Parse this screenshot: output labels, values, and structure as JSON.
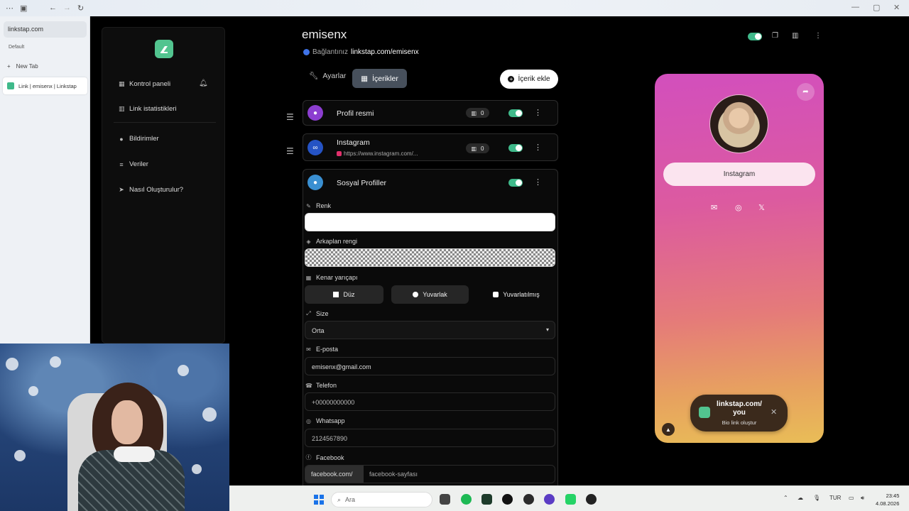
{
  "browser": {
    "address": "linkstap.com",
    "profile": "Default",
    "new_tab": "New Tab",
    "active_tab": "Link | emisenx | Linkstap"
  },
  "sidebar": {
    "items": [
      {
        "label": "Kontrol paneli",
        "icon": "table-icon"
      },
      {
        "label": "Link istatistikleri",
        "icon": "chart-icon"
      },
      {
        "label": "Bildirimler",
        "icon": "bell-icon"
      },
      {
        "label": "Veriler",
        "icon": "database-icon"
      },
      {
        "label": "Nasıl Oluşturulur?",
        "icon": "rocket-icon"
      }
    ]
  },
  "header": {
    "username": "emisenx",
    "link_prefix": "Bağlantınız",
    "link_url": "linkstap.com/emisenx"
  },
  "tabs": {
    "settings": "Ayarlar",
    "contents": "İçerikler",
    "add_content": "İçerik ekle"
  },
  "cards": {
    "profile": {
      "title": "Profil resmi",
      "clicks": "0"
    },
    "instagram": {
      "title": "Instagram",
      "url": "https://www.instagram.com/...",
      "clicks": "0"
    },
    "social": {
      "title": "Sosyal Profiller"
    }
  },
  "form": {
    "color_label": "Renk",
    "bg_color_label": "Arkaplan rengi",
    "radius_label": "Kenar yarıçapı",
    "radius_options": [
      "Düz",
      "Yuvarlak",
      "Yuvarlatılmış"
    ],
    "size_label": "Size",
    "size_value": "Orta",
    "email_label": "E-posta",
    "email_value": "emisenx@gmail.com",
    "phone_label": "Telefon",
    "phone_placeholder": "+00000000000",
    "whatsapp_label": "Whatsapp",
    "whatsapp_placeholder": "2124567890",
    "facebook_label": "Facebook",
    "facebook_prefix": "facebook.com/",
    "facebook_placeholder": "facebook-sayfası"
  },
  "preview": {
    "link_button": "Instagram",
    "toast_title": "linkstap.com/ you",
    "toast_sub": "Bio link oluştur"
  },
  "taskbar": {
    "search_placeholder": "Ara",
    "lang": "TUR",
    "time": "23:45",
    "date": "4.08.2026"
  },
  "colors": {
    "accent_green": "#3fb98a",
    "preview_gradient_top": "#d24fbd",
    "preview_gradient_bottom": "#e9bd57"
  }
}
